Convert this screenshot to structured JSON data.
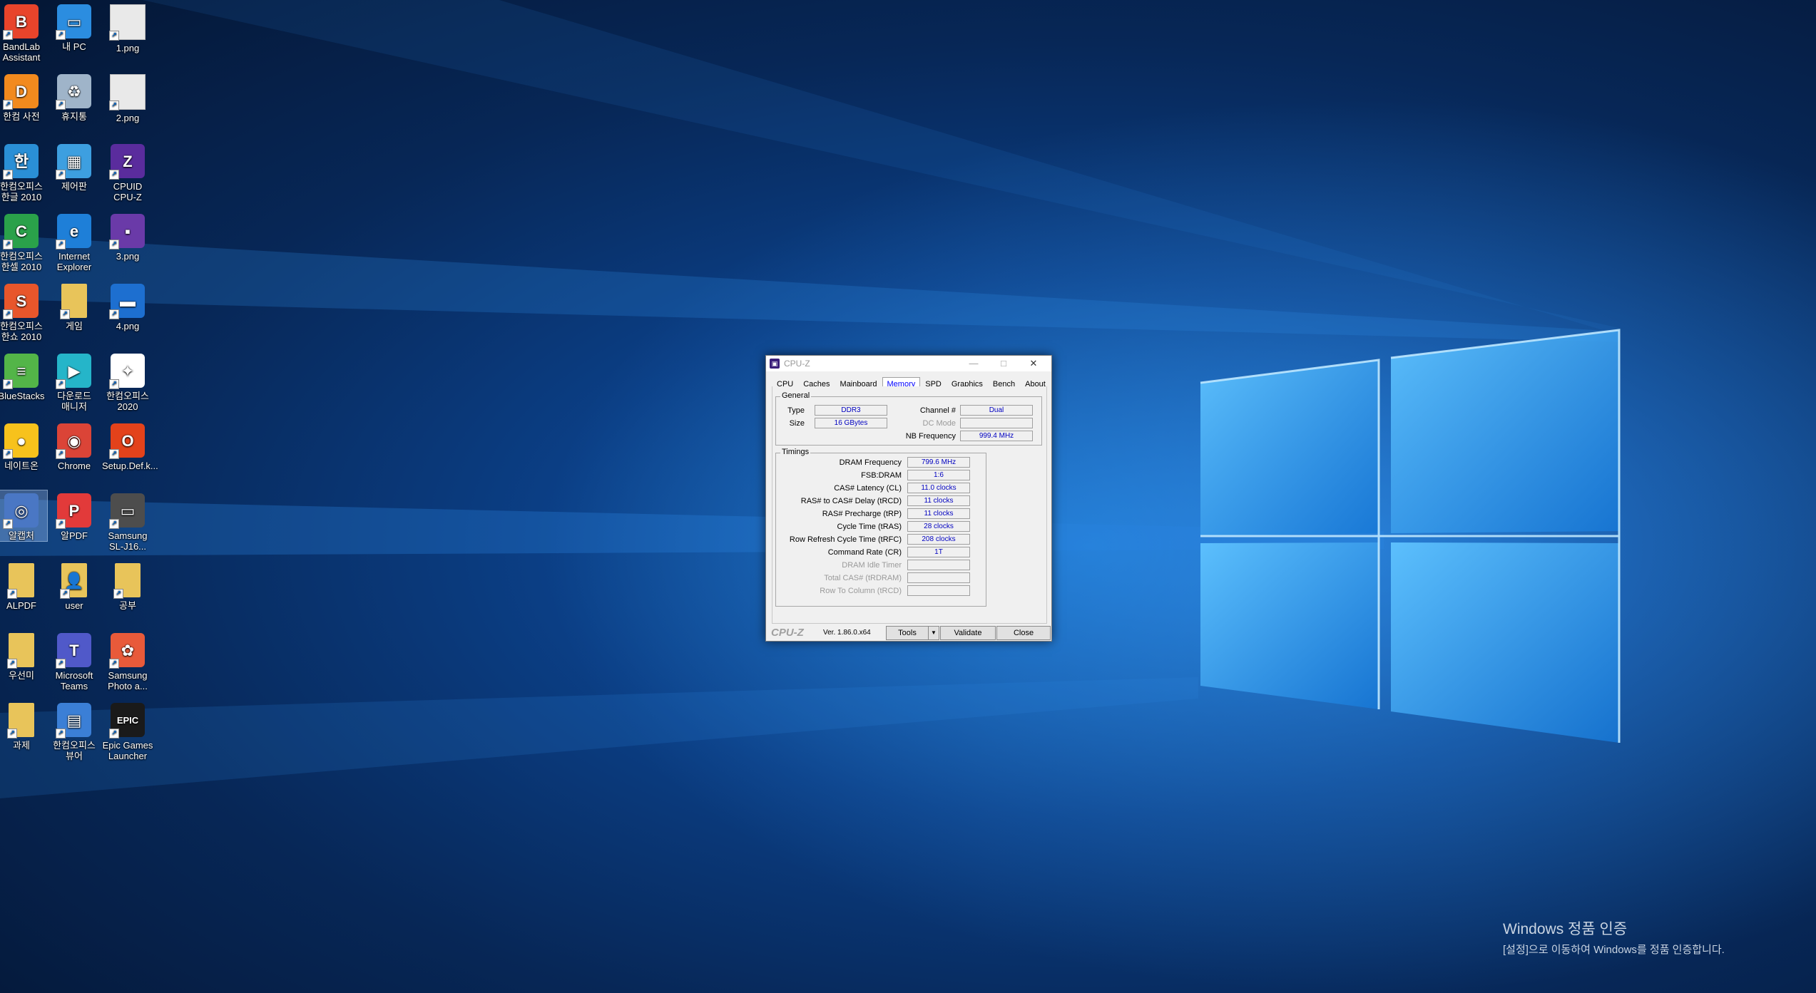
{
  "desktop": {
    "icons": [
      {
        "label": "BandLab\nAssistant",
        "icon": "bandlab-icon",
        "color": "#e8442b",
        "glyph": "B"
      },
      {
        "label": "내 PC",
        "icon": "this-pc-icon",
        "color": "#2b8de0",
        "glyph": "▭"
      },
      {
        "label": "1.png",
        "icon": "image-file-icon",
        "color": "#e9e9e9",
        "glyph": ""
      },
      {
        "label": "한컴 사전",
        "icon": "hancom-dictionary-icon",
        "color": "#f28a1e",
        "glyph": "D"
      },
      {
        "label": "휴지통",
        "icon": "recycle-bin-icon",
        "color": "#9fb4c9",
        "glyph": "♻"
      },
      {
        "label": "2.png",
        "icon": "image-file-icon",
        "color": "#e9e9e9",
        "glyph": ""
      },
      {
        "label": "한컴오피스\n한글 2010",
        "icon": "hancom-hwp-icon",
        "color": "#2a8fd6",
        "glyph": "한"
      },
      {
        "label": "제어판",
        "icon": "control-panel-icon",
        "color": "#3d9fe0",
        "glyph": "▦"
      },
      {
        "label": "CPUID\nCPU-Z",
        "icon": "cpuz-icon",
        "color": "#5a2c9d",
        "glyph": "Z"
      },
      {
        "label": "한컴오피스\n한셀 2010",
        "icon": "hancom-cell-icon",
        "color": "#2aa14a",
        "glyph": "C"
      },
      {
        "label": "Internet\nExplorer",
        "icon": "internet-explorer-icon",
        "color": "#1e7fd8",
        "glyph": "e"
      },
      {
        "label": "3.png",
        "icon": "image-file-icon",
        "color": "#6a3aa8",
        "glyph": "▪"
      },
      {
        "label": "한컴오피스\n한쇼 2010",
        "icon": "hancom-show-icon",
        "color": "#e8562b",
        "glyph": "S"
      },
      {
        "label": "게임",
        "icon": "folder-icon",
        "color": "#e8c45a",
        "glyph": ""
      },
      {
        "label": "4.png",
        "icon": "image-file-icon",
        "color": "#1d6fd0",
        "glyph": "▬"
      },
      {
        "label": "BlueStacks",
        "icon": "bluestacks-icon",
        "color": "#53b548",
        "glyph": "≡"
      },
      {
        "label": "다운로드\n매니저",
        "icon": "download-manager-icon",
        "color": "#25b5c9",
        "glyph": "▶"
      },
      {
        "label": "한컴오피스\n2020",
        "icon": "hancom-2020-icon",
        "color": "#ffffff",
        "glyph": "✦"
      },
      {
        "label": "네이트온",
        "icon": "nateon-icon",
        "color": "#f7c21c",
        "glyph": "●"
      },
      {
        "label": "Chrome",
        "icon": "chrome-icon",
        "color": "#db4437",
        "glyph": "◉"
      },
      {
        "label": "Setup.Def.k...",
        "icon": "office-icon",
        "color": "#e3421b",
        "glyph": "O"
      },
      {
        "label": "알캡처",
        "icon": "alcapture-icon",
        "color": "#4a77c4",
        "glyph": "◎"
      },
      {
        "label": "알PDF",
        "icon": "alpdf-icon",
        "color": "#e23a3a",
        "glyph": "P"
      },
      {
        "label": "Samsung\nSL-J16...",
        "icon": "printer-icon",
        "color": "#4d4d4d",
        "glyph": "▭"
      },
      {
        "label": "ALPDF",
        "icon": "folder-icon",
        "color": "#e8c45a",
        "glyph": ""
      },
      {
        "label": "user",
        "icon": "user-folder-icon",
        "color": "#e8c45a",
        "glyph": "👤"
      },
      {
        "label": "공부",
        "icon": "folder-icon",
        "color": "#e8c45a",
        "glyph": ""
      },
      {
        "label": "우선미",
        "icon": "folder-icon",
        "color": "#e8c45a",
        "glyph": ""
      },
      {
        "label": "Microsoft\nTeams",
        "icon": "teams-icon",
        "color": "#5059c9",
        "glyph": "T"
      },
      {
        "label": "Samsung\nPhoto a...",
        "icon": "samsung-photo-icon",
        "color": "#e85a3a",
        "glyph": "✿"
      },
      {
        "label": "과제",
        "icon": "folder-icon",
        "color": "#e8c45a",
        "glyph": ""
      },
      {
        "label": "한컴오피스\n뷰어",
        "icon": "hancom-viewer-icon",
        "color": "#3b7fd6",
        "glyph": "▤"
      },
      {
        "label": "Epic Games\nLauncher",
        "icon": "epic-games-icon",
        "color": "#1a1a1a",
        "glyph": "EPIC"
      }
    ]
  },
  "cpuz": {
    "title": "CPU-Z",
    "tabs": [
      "CPU",
      "Caches",
      "Mainboard",
      "Memory",
      "SPD",
      "Graphics",
      "Bench",
      "About"
    ],
    "active_tab": "Memory",
    "general": {
      "title": "General",
      "type_label": "Type",
      "type_value": "DDR3",
      "size_label": "Size",
      "size_value": "16 GBytes",
      "channel_label": "Channel #",
      "channel_value": "Dual",
      "dc_mode_label": "DC Mode",
      "dc_mode_value": "",
      "nb_freq_label": "NB Frequency",
      "nb_freq_value": "999.4 MHz"
    },
    "timings": {
      "title": "Timings",
      "rows": [
        {
          "label": "DRAM Frequency",
          "value": "799.6 MHz",
          "dim": false
        },
        {
          "label": "FSB:DRAM",
          "value": "1:6",
          "dim": false
        },
        {
          "label": "CAS# Latency (CL)",
          "value": "11.0 clocks",
          "dim": false
        },
        {
          "label": "RAS# to CAS# Delay (tRCD)",
          "value": "11 clocks",
          "dim": false
        },
        {
          "label": "RAS# Precharge (tRP)",
          "value": "11 clocks",
          "dim": false
        },
        {
          "label": "Cycle Time (tRAS)",
          "value": "28 clocks",
          "dim": false
        },
        {
          "label": "Row Refresh Cycle Time (tRFC)",
          "value": "208 clocks",
          "dim": false
        },
        {
          "label": "Command Rate (CR)",
          "value": "1T",
          "dim": false
        },
        {
          "label": "DRAM Idle Timer",
          "value": "",
          "dim": true
        },
        {
          "label": "Total CAS# (tRDRAM)",
          "value": "",
          "dim": true
        },
        {
          "label": "Row To Column (tRCD)",
          "value": "",
          "dim": true
        }
      ]
    },
    "footer": {
      "brand": "CPU-Z",
      "version": "Ver. 1.86.0.x64",
      "tools_label": "Tools",
      "validate_label": "Validate",
      "close_label": "Close"
    }
  },
  "activation": {
    "line1": "Windows 정품 인증",
    "line2": "[설정]으로 이동하여 Windows를 정품 인증합니다."
  }
}
